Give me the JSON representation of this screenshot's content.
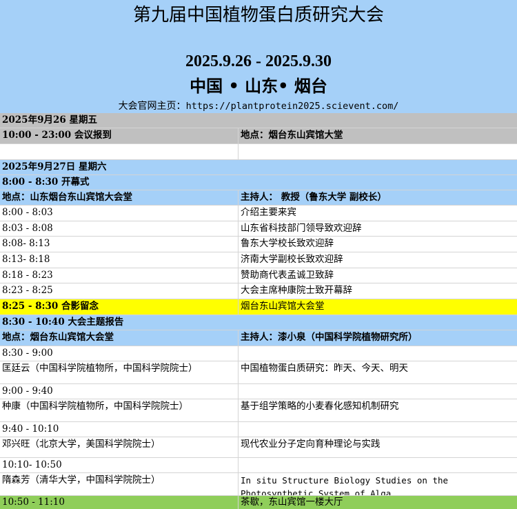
{
  "header": {
    "title": "第九届中国植物蛋白质研究大会",
    "dates": "2025.9.26 - 2025.9.30",
    "location": "中国 • 山东• 烟台",
    "site_label": "大会官网主页：",
    "site_url": "https://plantprotein2025.scievent.com/"
  },
  "day1": {
    "date": "2025年9月26  星期五",
    "reg_time": "10:00 - 23:00 会议报到",
    "reg_place": "地点：烟台东山宾馆大堂"
  },
  "day2": {
    "date": "2025年9月27日 星期六",
    "opening_title": "8:00 - 8:30 开幕式",
    "opening_place": "地点：山东烟台东山宾馆大会堂",
    "opening_host": "主持人： 教授（鲁东大学 副校长）",
    "opening_items": [
      {
        "time": "8:00 - 8:03",
        "item": "介绍主要来宾"
      },
      {
        "time": "8:03 - 8:08",
        "item": "山东省科技部门领导致欢迎辞"
      },
      {
        "time": "8:08- 8:13",
        "item": "鲁东大学校长致欢迎辞"
      },
      {
        "time": "8:13- 8:18",
        "item": "济南大学副校长致欢迎辞"
      },
      {
        "time": "8:18 - 8:23",
        "item": "赞助商代表孟诚卫致辞"
      },
      {
        "time": "8:23 - 8:25",
        "item": "大会主席种康院士致开幕辞"
      }
    ],
    "photo_time": "8:25 - 8:30 合影留念",
    "photo_place": "烟台东山宾馆大会堂",
    "keynote_title": "8:30 - 10:40 大会主题报告",
    "keynote_place": "地点：烟台东山宾馆大会堂",
    "keynote_host": "主持人：漆小泉（中国科学院植物研究所）",
    "talks": [
      {
        "time": "8:30 - 9:00",
        "speaker": "匡廷云（中国科学院植物所，中国科学院院士）",
        "title": "中国植物蛋白质研究：昨天、今天、明天"
      },
      {
        "time": "9:00 - 9:40",
        "speaker": "种康（中国科学院植物所，中国科学院院士）",
        "title": "基于组学策略的小麦春化感知机制研究"
      },
      {
        "time": "9:40 - 10:10",
        "speaker": "邓兴旺（北京大学，美国科学院院士）",
        "title": "现代农业分子定向育种理论与实践"
      },
      {
        "time": "10:10- 10:50",
        "speaker": "隋森芳（清华大学，中国科学院院士）",
        "title": "In situ Structure Biology Studies on the Photosynthetic System of Alga"
      }
    ],
    "break_time": "10:50 - 11:10",
    "break_item": "茶歇，东山宾馆一楼大厅"
  }
}
